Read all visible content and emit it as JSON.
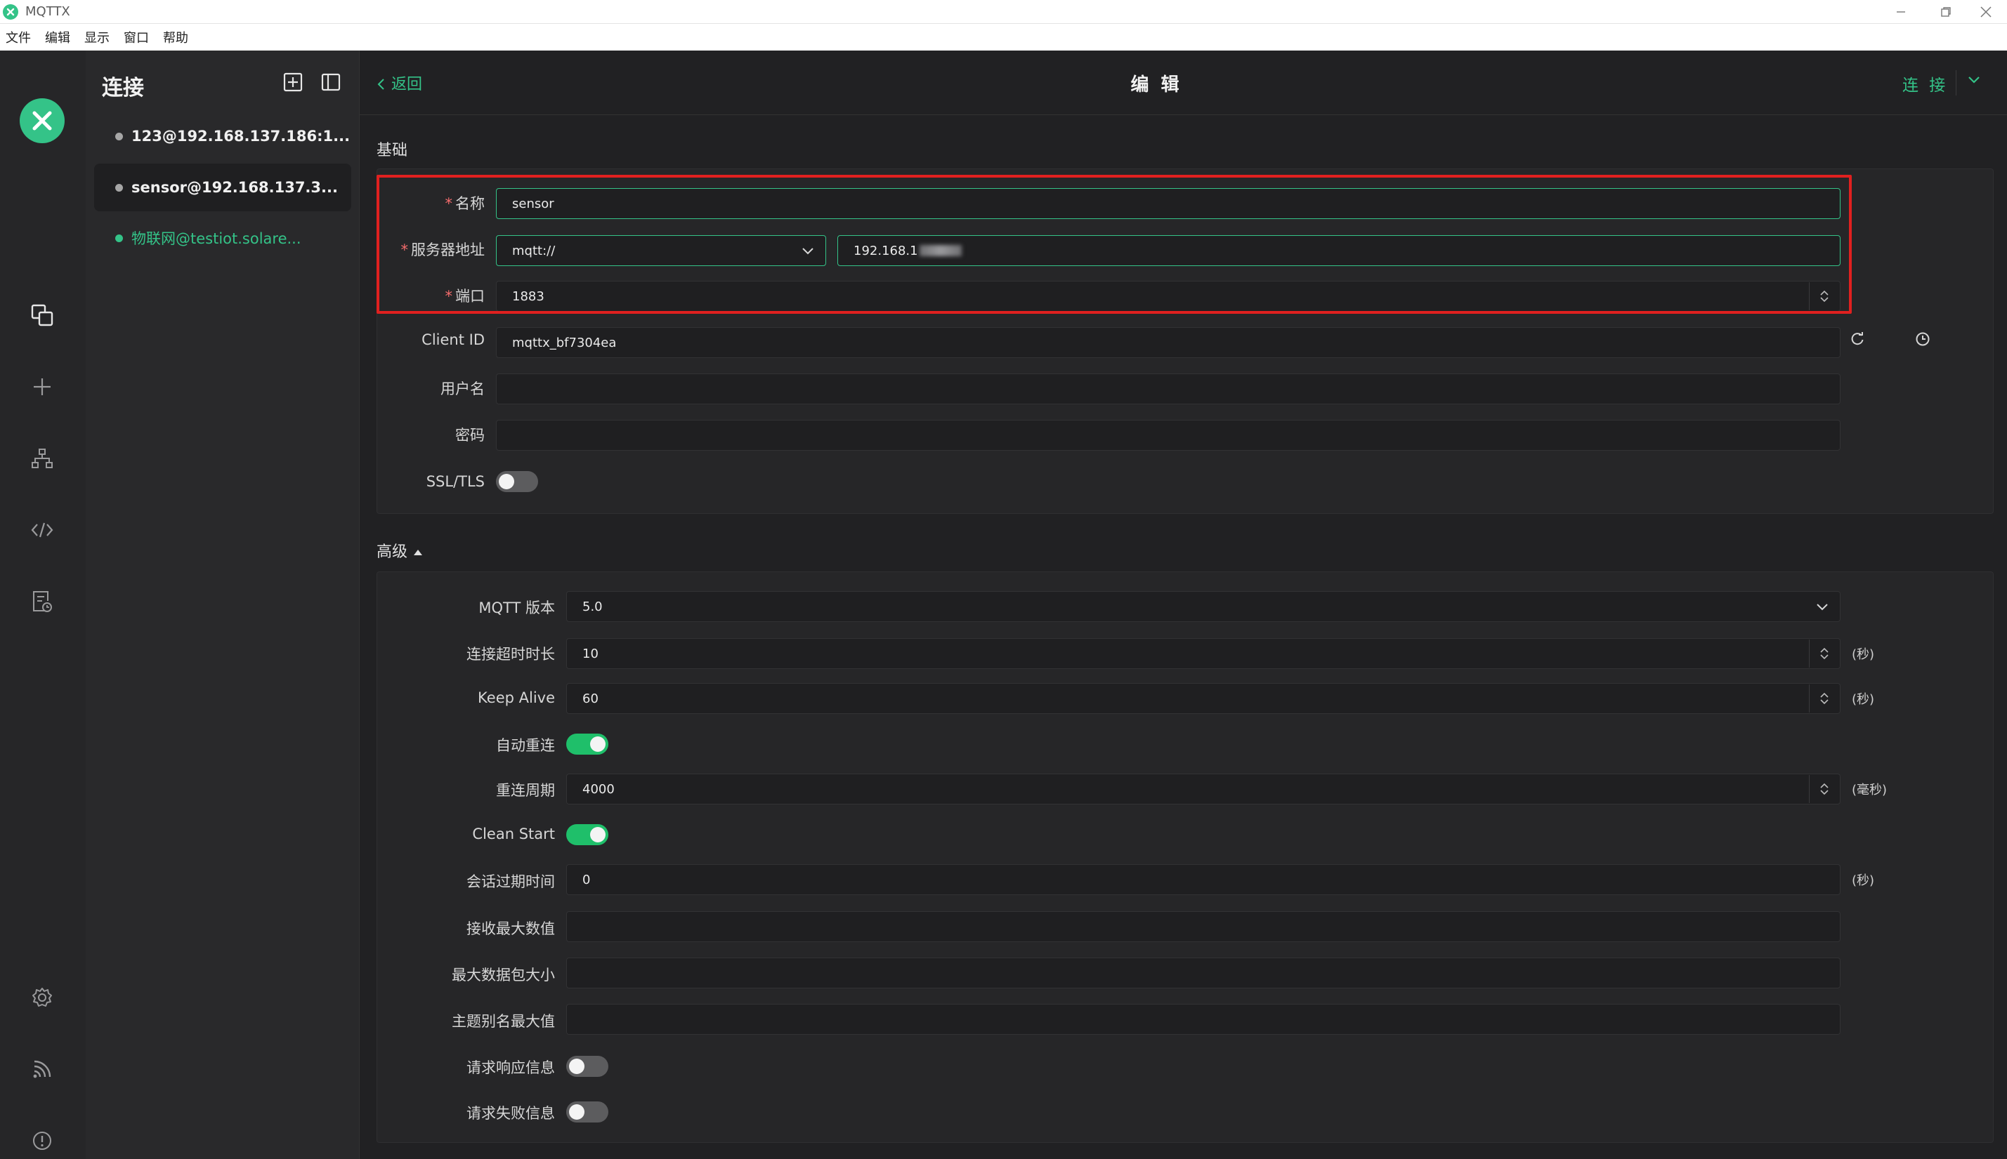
{
  "window": {
    "title": "MQTTX"
  },
  "menu": [
    "文件",
    "编辑",
    "显示",
    "窗口",
    "帮助"
  ],
  "colors": {
    "accent": "#34c388",
    "required": "#f56c6c",
    "highlight_box": "#e0201f"
  },
  "connections_panel": {
    "title": "连接",
    "items": [
      {
        "label": "123@192.168.137.186:1...",
        "status": "offline"
      },
      {
        "label": "sensor@192.168.137.3...",
        "status": "offline",
        "selected": true
      },
      {
        "label": "物联网@testiot.solare...",
        "status": "online"
      }
    ]
  },
  "topbar": {
    "back": "返回",
    "title": "编 辑",
    "connect": "连 接"
  },
  "basic": {
    "section": "基础",
    "name_label": "名称",
    "name_value": "sensor",
    "host_label": "服务器地址",
    "protocol_value": "mqtt://",
    "host_value": "192.168.1",
    "port_label": "端口",
    "port_value": "1883",
    "client_id_label": "Client ID",
    "client_id_value": "mqttx_bf7304ea",
    "username_label": "用户名",
    "username_value": "",
    "password_label": "密码",
    "password_value": "",
    "ssl_label": "SSL/TLS",
    "ssl_on": false
  },
  "advanced": {
    "section": "高级",
    "mqtt_version_label": "MQTT 版本",
    "mqtt_version_value": "5.0",
    "connect_timeout_label": "连接超时时长",
    "connect_timeout_value": "10",
    "connect_timeout_unit": "(秒)",
    "keep_alive_label": "Keep Alive",
    "keep_alive_value": "60",
    "keep_alive_unit": "(秒)",
    "auto_reconnect_label": "自动重连",
    "auto_reconnect_on": true,
    "reconnect_period_label": "重连周期",
    "reconnect_period_value": "4000",
    "reconnect_period_unit": "(毫秒)",
    "clean_start_label": "Clean Start",
    "clean_start_on": true,
    "session_expiry_label": "会话过期时间",
    "session_expiry_value": "0",
    "session_expiry_unit": "(秒)",
    "receive_max_label": "接收最大数值",
    "max_packet_label": "最大数据包大小",
    "topic_alias_label": "主题别名最大值",
    "request_response_label": "请求响应信息",
    "request_response_on": false,
    "request_problem_label": "请求失败信息",
    "request_problem_on": false
  }
}
